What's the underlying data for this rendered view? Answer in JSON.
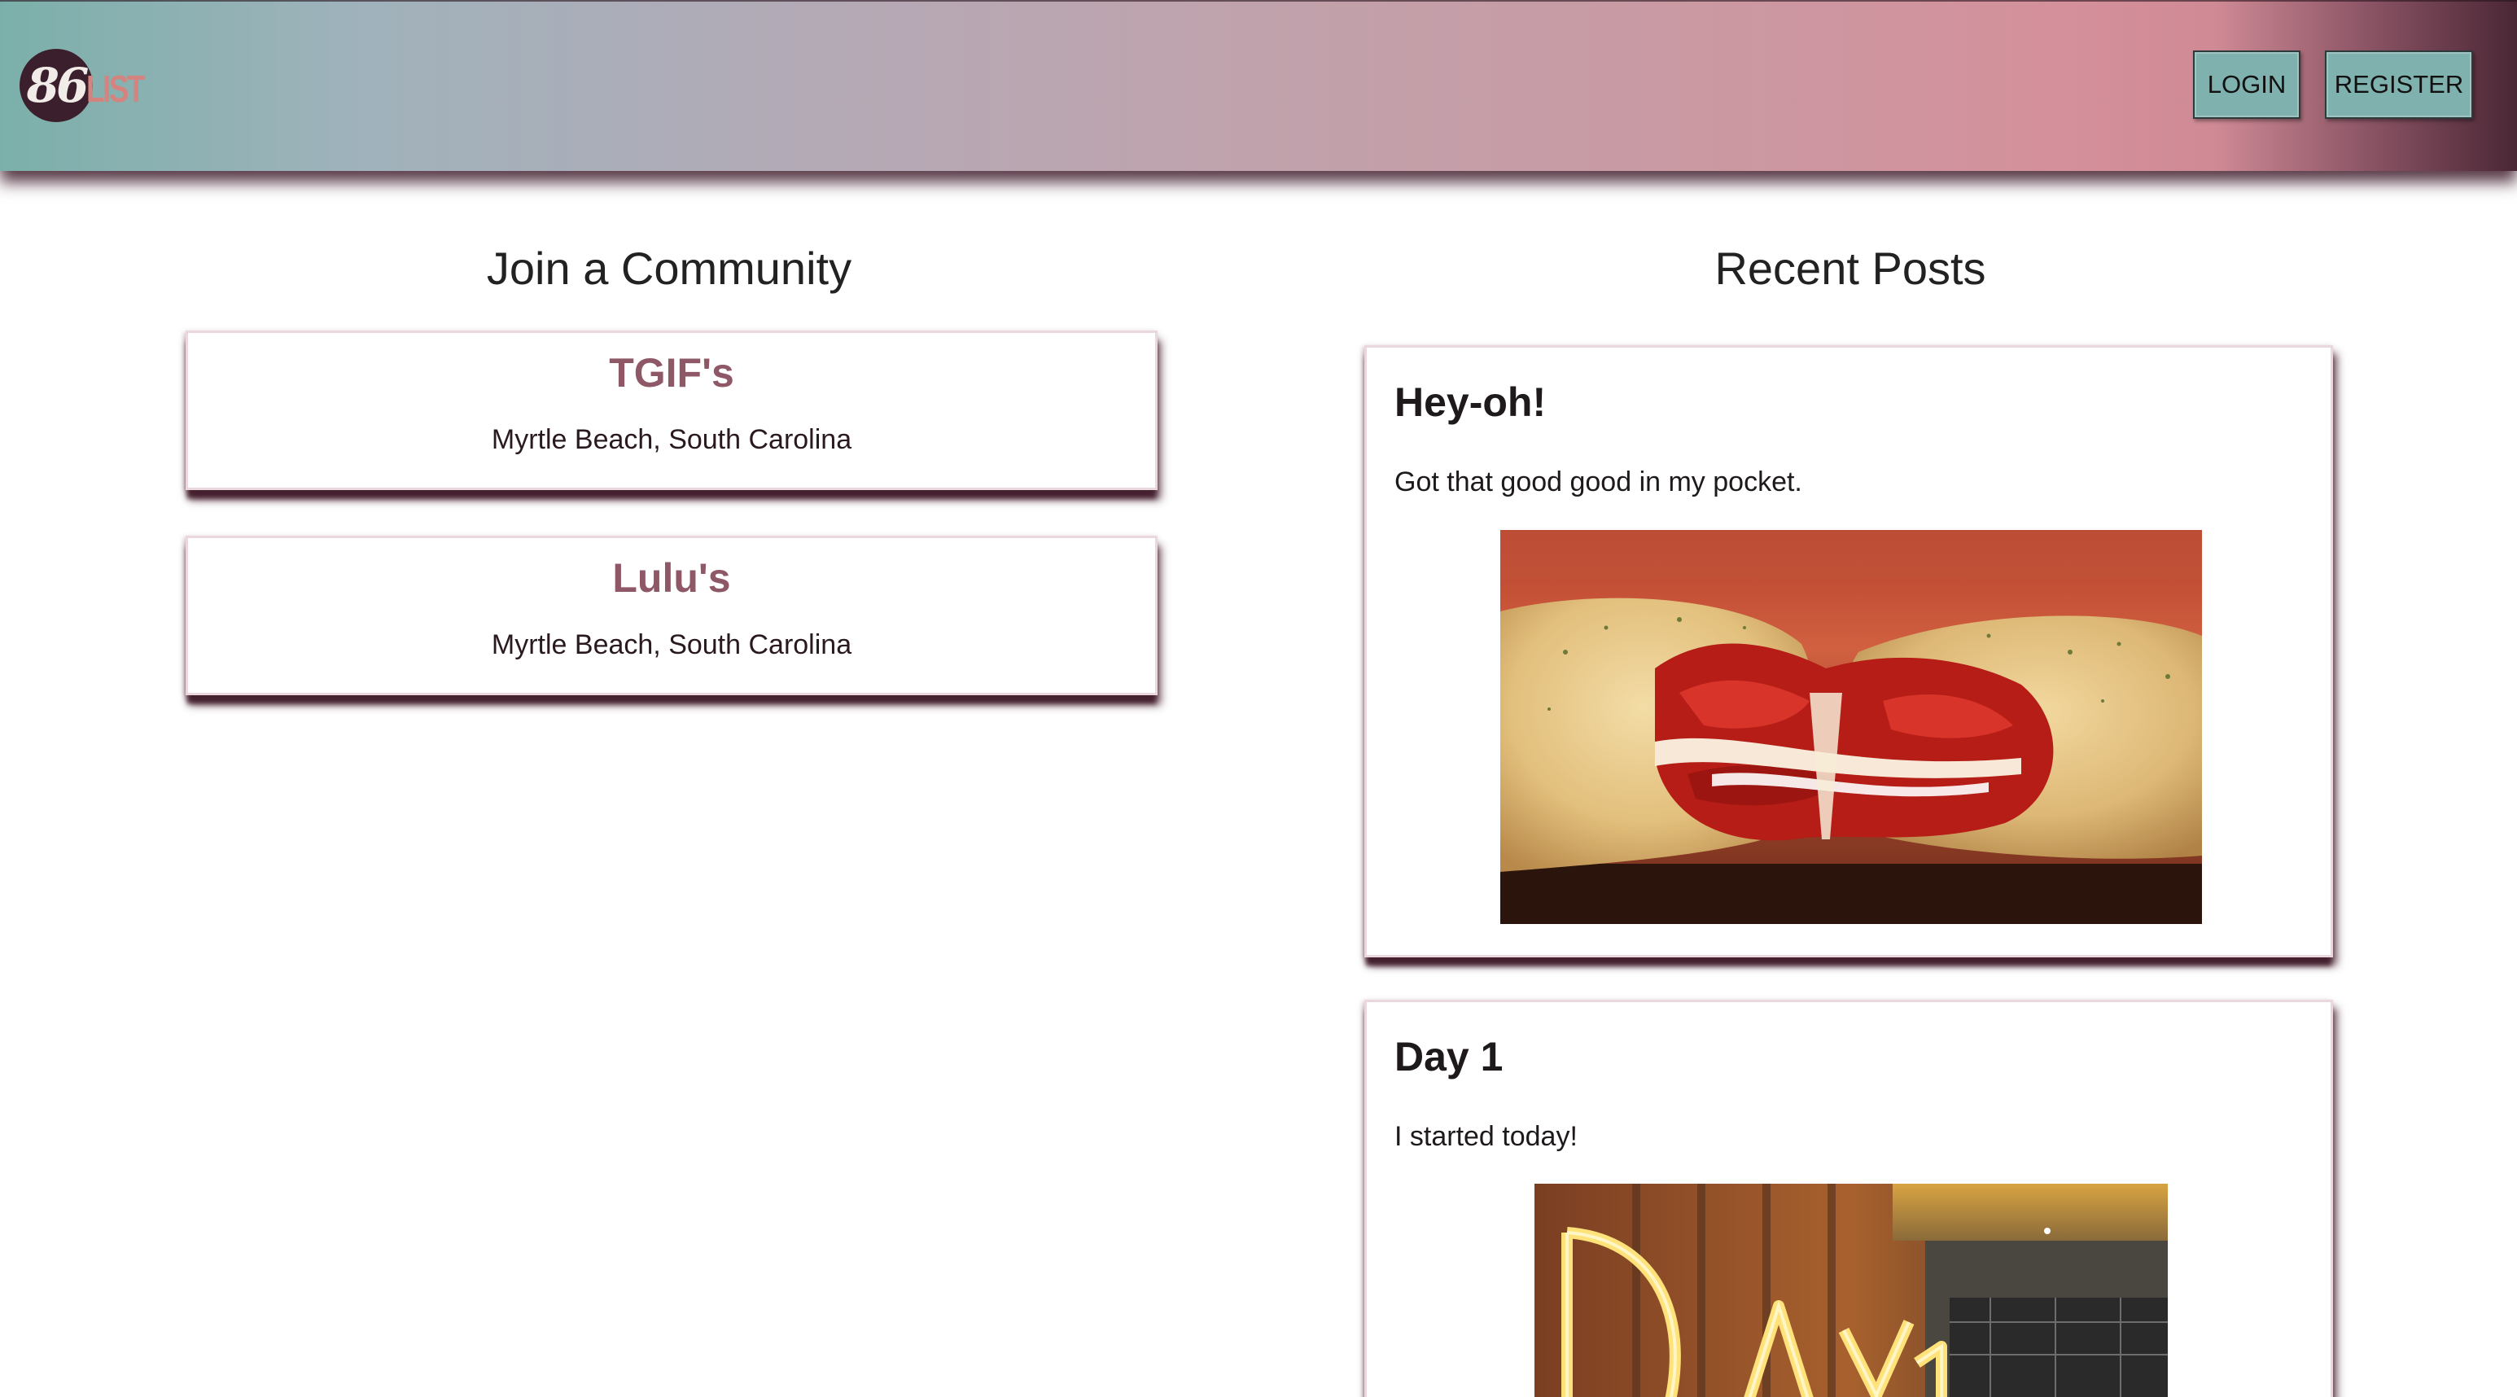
{
  "header": {
    "logo": {
      "number": "86",
      "word": "LIST"
    },
    "nav": {
      "login_label": "LOGIN",
      "register_label": "REGISTER"
    }
  },
  "communities": {
    "title": "Join a Community",
    "items": [
      {
        "name": "TGIF's",
        "location": "Myrtle Beach, South Carolina"
      },
      {
        "name": "Lulu's",
        "location": "Myrtle Beach, South Carolina"
      }
    ]
  },
  "recent_posts": {
    "title": "Recent Posts",
    "items": [
      {
        "title": "Hey-oh!",
        "body": "Got that good good in my pocket.",
        "image": "calzone-photo"
      },
      {
        "title": "Day 1",
        "body": "I started today!",
        "image": "day-1-neon-sign-photo"
      }
    ]
  },
  "colors": {
    "header_gradient": [
      "#7bb0aa",
      "#b3aab6",
      "#d4909b",
      "#4a2634"
    ],
    "nav_button": "#7fb1ae",
    "community_name": "#8e5867",
    "card_shadow": "#45202f"
  }
}
